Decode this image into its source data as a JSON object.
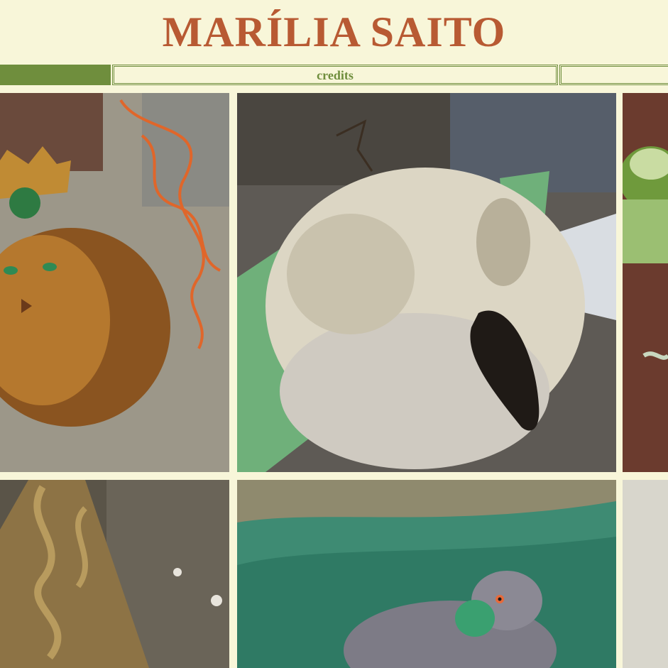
{
  "header": {
    "title": "MARÍLIA SAITO"
  },
  "nav": {
    "credits_label": "credits"
  },
  "colors": {
    "background": "#f8f6d9",
    "title": "#b85a33",
    "accent_green": "#6f8e3d"
  },
  "gallery": {
    "items": [
      {
        "name": "lion-sculpture",
        "description": "gold lion face sculpture with crown and green gem"
      },
      {
        "name": "bird-skull-sculpture",
        "description": "white bird skull sculpture with dark beak"
      },
      {
        "name": "green-embroidery",
        "description": "green textile piece on brown fabric"
      },
      {
        "name": "bronze-ornament",
        "description": "bronze carved decorative panel"
      },
      {
        "name": "pigeon-painting",
        "description": "painting of a pigeon over green water"
      },
      {
        "name": "partial-light-tile",
        "description": "partially visible light tile"
      }
    ]
  }
}
